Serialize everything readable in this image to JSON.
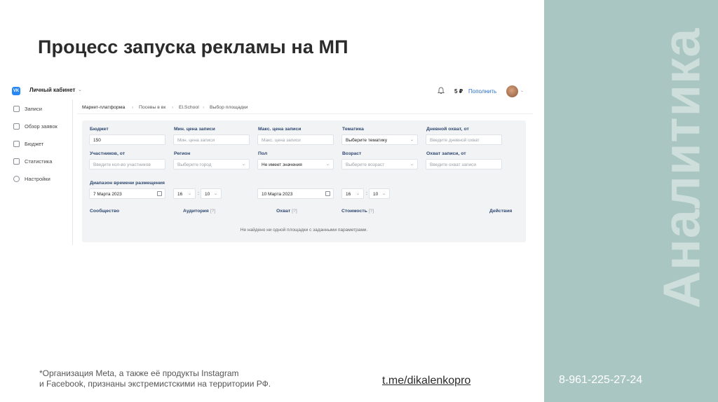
{
  "slide": {
    "title": "Процесс запуска рекламы на МП",
    "side_word": "Аналитика",
    "phone": "8-961-225-27-24",
    "footnote_line1": "*Организация Meta, а также её продукты Instagram",
    "footnote_line2": "и Facebook, признаны экстремистскими на территории РФ.",
    "link": "t.me/dikalenkopro",
    "panel_color": "#a9c6c2"
  },
  "app": {
    "logo_text": "VK",
    "cabinet_title": "Личный кабинет",
    "balance": "5 ₽",
    "topup_label": "Пополнить",
    "accent": "#2787f5"
  },
  "sidebar": {
    "items": [
      {
        "label": "Записи",
        "icon": "megaphone-icon"
      },
      {
        "label": "Обзор заявок",
        "icon": "list-icon"
      },
      {
        "label": "Бюджет",
        "icon": "wallet-icon"
      },
      {
        "label": "Статистика",
        "icon": "chart-icon"
      },
      {
        "label": "Настройки",
        "icon": "gear-icon"
      }
    ]
  },
  "breadcrumbs": [
    "Маркет-платформа",
    "Посевы в вк",
    "El.School",
    "Выбор площадки"
  ],
  "filters": {
    "budget": {
      "label": "Бюджет",
      "value": "150"
    },
    "min_price": {
      "label": "Мин. цена записи",
      "placeholder": "Мин. цена записи"
    },
    "max_price": {
      "label": "Макс. цена записи",
      "placeholder": "Макс. цена записи"
    },
    "topic": {
      "label": "Тематика",
      "value": "Выберите тематику"
    },
    "daily_reach": {
      "label": "Дневной охват, от",
      "placeholder": "Введите дневной охват"
    },
    "members": {
      "label": "Участников, от",
      "placeholder": "Введите кол-во участников"
    },
    "region": {
      "label": "Регион",
      "value": "Выберите город"
    },
    "gender": {
      "label": "Пол",
      "value": "Не имеет значения"
    },
    "age": {
      "label": "Возраст",
      "value": "Выберите возраст"
    },
    "post_reach": {
      "label": "Охват записи, от",
      "placeholder": "Введите охват записи"
    },
    "period": {
      "label": "Диапазон времени размещения",
      "start_date": "7 Марта 2023",
      "start_hour": "16",
      "start_min": "10",
      "end_date": "10 Марта 2023",
      "end_hour": "16",
      "end_min": "10",
      "colon": ":"
    }
  },
  "table": {
    "columns": [
      {
        "label": "Сообщество",
        "hint": ""
      },
      {
        "label": "Аудитория",
        "hint": "[?]"
      },
      {
        "label": "Охват",
        "hint": "[?]"
      },
      {
        "label": "Стоимость",
        "hint": "[?]"
      },
      {
        "label": "Действия",
        "hint": ""
      }
    ],
    "empty_message": "Не найдено ни одной площадки с заданными параметрами."
  }
}
